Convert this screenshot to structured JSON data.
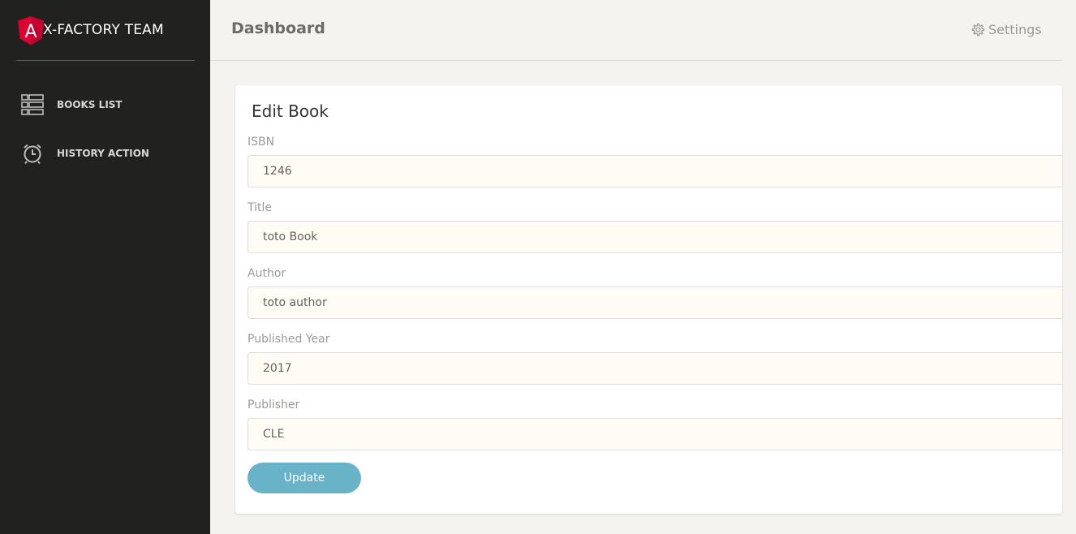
{
  "sidebar": {
    "brand_title": "X-FACTORY TEAM",
    "logo_letter": "A",
    "items": [
      {
        "label": "BOOKS LIST",
        "icon": "list-icon"
      },
      {
        "label": "HISTORY ACTION",
        "icon": "alarm-clock-icon"
      }
    ]
  },
  "header": {
    "title": "Dashboard",
    "settings_label": "Settings"
  },
  "form": {
    "title": "Edit Book",
    "fields": [
      {
        "label": "ISBN",
        "value": "1246"
      },
      {
        "label": "Title",
        "value": "toto Book"
      },
      {
        "label": "Author",
        "value": "toto author"
      },
      {
        "label": "Published Year",
        "value": "2017"
      },
      {
        "label": "Publisher",
        "value": "CLE"
      }
    ],
    "submit_label": "Update"
  },
  "colors": {
    "sidebar_bg": "#212120",
    "page_bg": "#f4f3ef",
    "logo_red": "#dd0031",
    "button": "#68b3c8",
    "input_bg": "#fffcf5"
  }
}
